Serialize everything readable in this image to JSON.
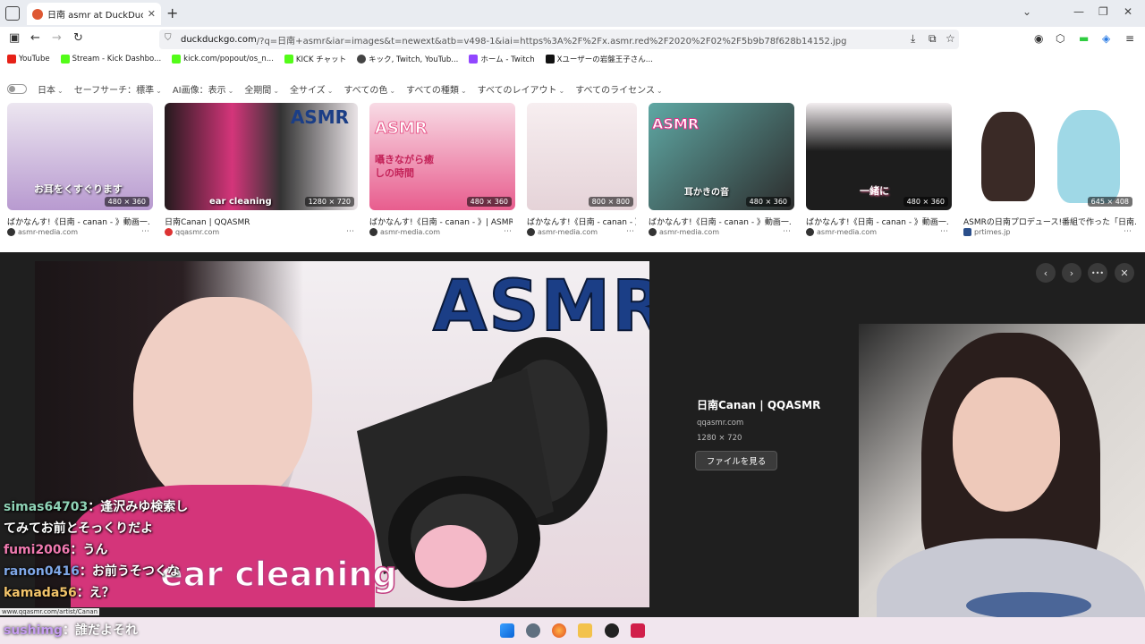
{
  "browser": {
    "tab_title": "日南 asmr at DuckDuckGo",
    "url_host": "duckduckgo.com",
    "url_rest": "/?q=日南+asmr&iar=images&t=newext&atb=v498-1&iai=https%3A%2F%2Fx.asmr.red%2F2020%2F02%2F5b9b78f628b14152.jpg",
    "bookmarks": [
      "YouTube",
      "Stream - Kick Dashbo...",
      "kick.com/popout/os_n...",
      "KICK チャット",
      "キック, Twitch, YouTub...",
      "ホーム - Twitch",
      "Xユーザーの岩盤王子さん..."
    ]
  },
  "filters": {
    "region": "日本",
    "safesearch": "セーフサーチ：標準",
    "ai_images": "AI画像：表示",
    "period": "全期間",
    "size": "全サイズ",
    "color": "すべての色",
    "type": "すべての種類",
    "layout": "すべてのレイアウト",
    "license": "すべてのライセンス"
  },
  "results": [
    {
      "caption": "ばかなんす!《日南 - canan - 》動画一...",
      "source": "asmr-media.com",
      "dims": "480 × 360",
      "thumb_text": "お耳をくすぐります",
      "accent": "#b89ad0"
    },
    {
      "caption": "日南Canan | QQASMR",
      "source": "qqasmr.com",
      "dims": "1280 × 720",
      "thumb_text": "ear cleaning",
      "accent": "#d4357a"
    },
    {
      "caption": "ばかなんす!《日南 - canan - 》| ASMR...",
      "source": "asmr-media.com",
      "dims": "480 × 360",
      "thumb_text": "囁きながら癒しの時間",
      "accent": "#e85d8e"
    },
    {
      "caption": "ばかなんす!《日南 - canan - 》動画一...",
      "source": "asmr-media.com",
      "dims": "800 × 800",
      "thumb_text": "",
      "accent": "#efe3e6"
    },
    {
      "caption": "ばかなんす!《日南 - canan - 》動画一...",
      "source": "asmr-media.com",
      "dims": "480 × 360",
      "thumb_text": "耳かきの音",
      "accent": "#2c2c2c"
    },
    {
      "caption": "ばかなんす!《日南 - canan - 》動画一...",
      "source": "asmr-media.com",
      "dims": "480 × 360",
      "thumb_text": "一緒に",
      "accent": "#1d1d1d"
    },
    {
      "caption": "ASMRの日南プロデュース!番組で作った「日南...",
      "source": "prtimes.jp",
      "dims": "645 × 408",
      "thumb_text": "",
      "accent": "#9fd8e6"
    }
  ],
  "preview": {
    "logo_text": "ASMR",
    "overlay_text": "ear cleaning",
    "title": "日南Canan | QQASMR",
    "host": "qqasmr.com",
    "dims": "1280 × 720",
    "button": "ファイルを見る",
    "prev": "‹",
    "next": "›",
    "more": "•••",
    "close": "✕"
  },
  "status_url": "www.qqasmr.com/artist/Canan",
  "chat": [
    {
      "user": "simas64703",
      "msg": "：逢沢みゆ検索し"
    },
    {
      "user": "",
      "msg": "てみてお前とそっくりだよ"
    },
    {
      "user": "fumi2006",
      "msg": "：うん"
    },
    {
      "user": "ranon0416",
      "msg": "：お前うそつくな"
    },
    {
      "user": "kamada56",
      "msg": "：え？"
    },
    {
      "user": "sushimg",
      "msg": "：誰だよそれ"
    }
  ],
  "colors": {
    "ddg_orange": "#de5833",
    "preview_bg": "#1f1f1f",
    "taskbar": "#f1e6ee"
  }
}
